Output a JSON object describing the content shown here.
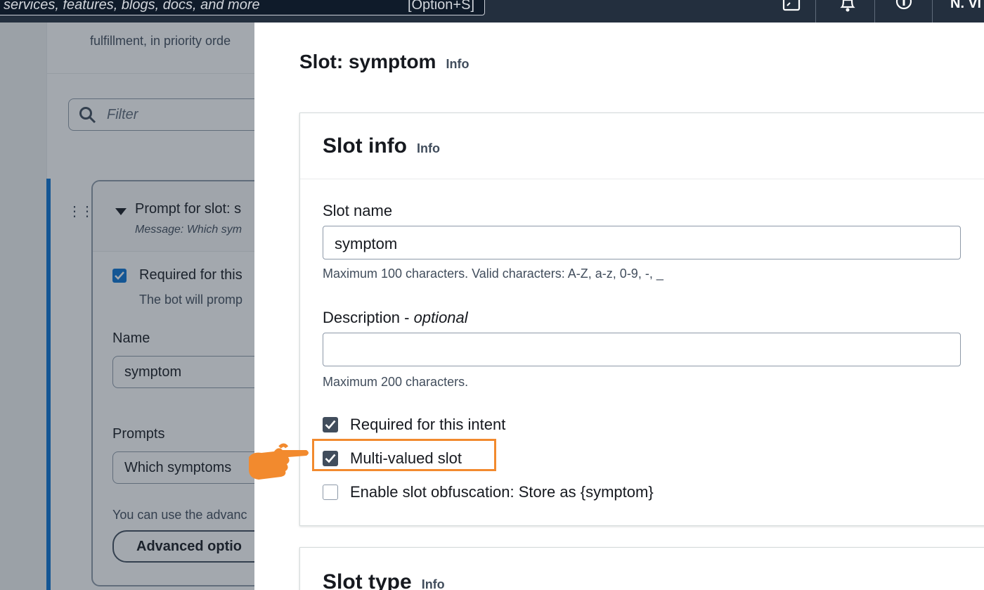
{
  "topbar": {
    "search_placeholder": "services, features, blogs, docs, and more",
    "search_shortcut": "[Option+S]",
    "icons": [
      "cloudshell-icon",
      "bell-icon",
      "help-icon"
    ],
    "user": "N. Vi"
  },
  "background": {
    "header_text": "fulfillment, in priority orde",
    "filter_placeholder": "Filter",
    "card": {
      "title": "Prompt for slot: s",
      "subtitle": "Message: Which sym",
      "required_label": "Required for this",
      "required_desc": "The bot will promp",
      "name_label": "Name",
      "name_value": "symptom",
      "prompts_label": "Prompts",
      "prompts_value": "Which symptoms",
      "advanced_hint": "You can use the advanc",
      "advanced_button": "Advanced optio"
    }
  },
  "modal": {
    "title": "Slot: symptom",
    "title_info": "Info",
    "slot_info": {
      "title": "Slot info",
      "info": "Info",
      "slot_name_label": "Slot name",
      "slot_name_value": "symptom",
      "slot_name_hint": "Maximum 100 characters. Valid characters: A-Z, a-z, 0-9, -, _",
      "description_label": "Description - ",
      "description_optional": "optional",
      "description_value": "",
      "description_hint": "Maximum 200 characters.",
      "checkboxes": [
        {
          "label": "Required for this intent",
          "checked": true
        },
        {
          "label": "Multi-valued slot",
          "checked": true
        },
        {
          "label": "Enable slot obfuscation: Store as {symptom}",
          "checked": false
        }
      ]
    },
    "slot_type": {
      "title": "Slot type",
      "info": "Info"
    }
  },
  "colors": {
    "topbar": "#232f3e",
    "highlight": "#f28a2e",
    "checkbox_checked": "#414d5c",
    "accent": "#0972d3"
  }
}
